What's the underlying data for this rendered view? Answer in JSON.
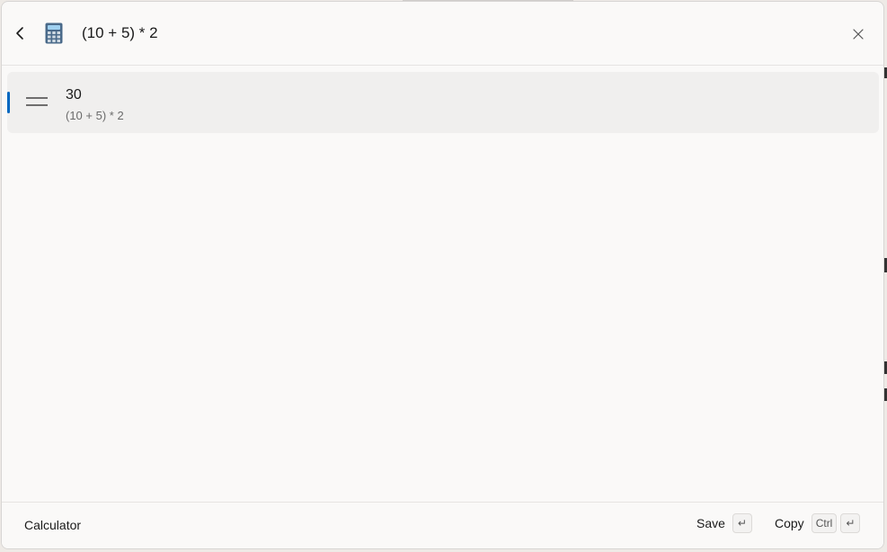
{
  "header": {
    "query": "(10 + 5) * 2",
    "app_icon": "calculator-icon",
    "back_icon": "chevron-left-icon",
    "close_icon": "close-icon"
  },
  "results": [
    {
      "icon": "equals-icon",
      "value": "30",
      "expression": "(10 + 5) * 2",
      "selected": true
    }
  ],
  "footer": {
    "title": "Calculator",
    "actions": [
      {
        "label": "Save",
        "keys": [
          "↵"
        ]
      },
      {
        "label": "Copy",
        "keys": [
          "Ctrl",
          "↵"
        ]
      }
    ]
  },
  "colors": {
    "accent": "#0067c0",
    "window_bg": "#faf9f8",
    "selected_bg": "#f0efee"
  }
}
